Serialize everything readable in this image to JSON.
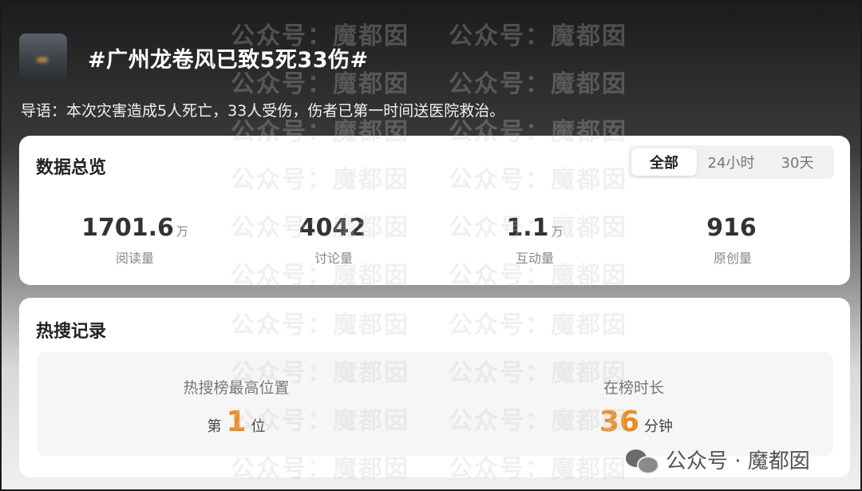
{
  "header": {
    "title": "#广州龙卷风已致5死33伤#",
    "intro": "导语：本次灾害造成5人死亡，33人受伤，伤者已第一时间送医院救治。"
  },
  "overview": {
    "title": "数据总览",
    "tabs": [
      "全部",
      "24小时",
      "30天"
    ],
    "active_tab": "全部",
    "stats": [
      {
        "value": "1701.6",
        "unit": "万",
        "label": "阅读量"
      },
      {
        "value": "4042",
        "unit": "",
        "label": "讨论量"
      },
      {
        "value": "1.1",
        "unit": "万",
        "label": "互动量"
      },
      {
        "value": "916",
        "unit": "",
        "label": "原创量"
      }
    ]
  },
  "hot_search": {
    "title": "热搜记录",
    "highest": {
      "label": "热搜榜最高位置",
      "prefix": "第",
      "value": "1",
      "suffix": "位"
    },
    "duration": {
      "label": "在榜时长",
      "value": "36",
      "suffix": "分钟"
    }
  },
  "watermark": "公众号：魔都囡",
  "brand": {
    "icon": "wechat-icon",
    "text": "公众号 · 魔都囡"
  },
  "colors": {
    "accent": "#f08a1c"
  }
}
